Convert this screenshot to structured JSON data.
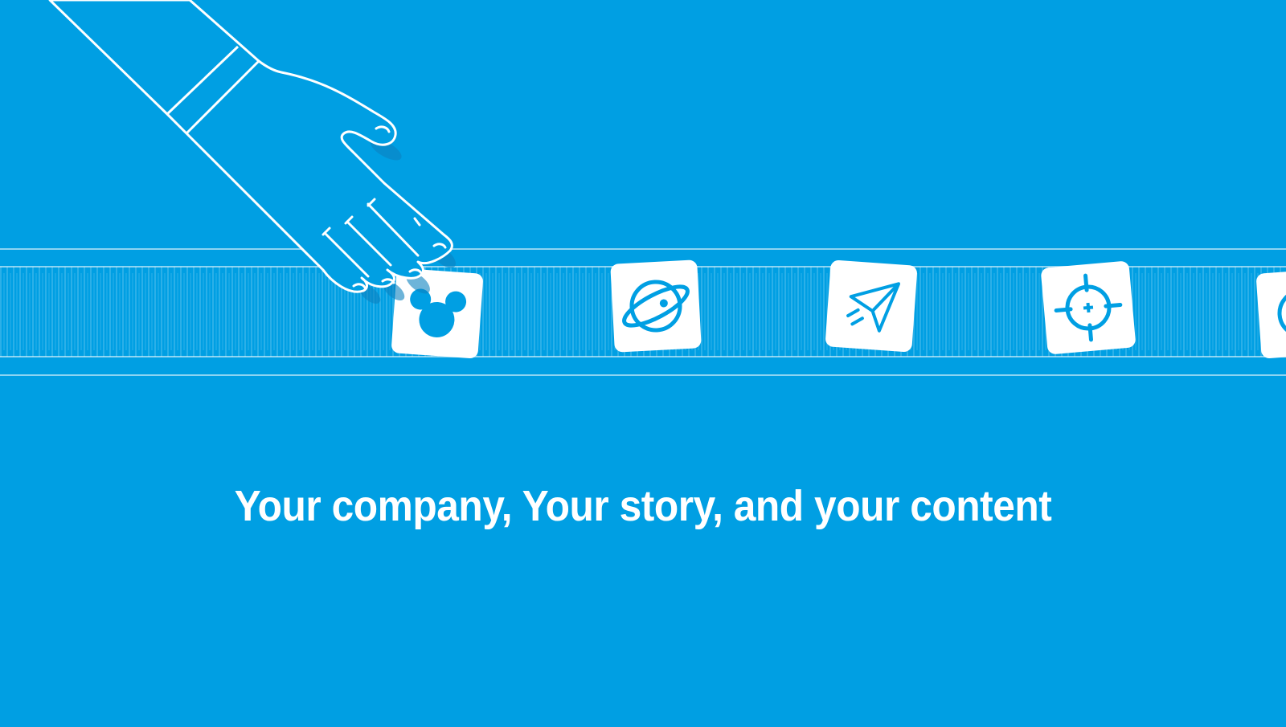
{
  "colors": {
    "background": "#009fe3",
    "line": "#ffffff",
    "tile": "#ffffff",
    "icon": "#009fe3"
  },
  "conveyor": {
    "tiles": [
      {
        "icon": "mouse-ears-icon"
      },
      {
        "icon": "planet-icon"
      },
      {
        "icon": "paper-plane-icon"
      },
      {
        "icon": "crosshair-icon"
      },
      {
        "icon": "partial-tile-icon"
      }
    ]
  },
  "illustration": {
    "hand": "hand-pointing-illustration"
  },
  "headline": {
    "text": "Your company, Your story, and your content"
  }
}
